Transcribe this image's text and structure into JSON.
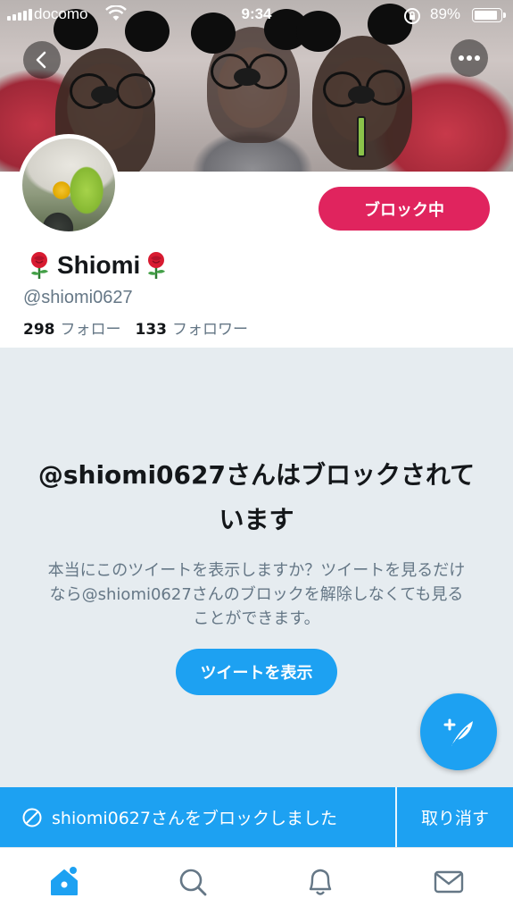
{
  "status_bar": {
    "carrier": "docomo",
    "time": "9:34",
    "battery_percent": "89%",
    "battery_level": 0.89,
    "icons": [
      "signal-bars-icon",
      "wifi-icon",
      "orientation-lock-icon",
      "battery-icon"
    ]
  },
  "header": {
    "back_icon": "chevron-left-icon",
    "more_icon": "more-dots-icon"
  },
  "profile": {
    "name_prefix_icon": "rose-icon",
    "display_name": "Shiomi",
    "name_suffix_icon": "rose-icon",
    "handle": "@shiomi0627",
    "following_count": "298",
    "following_label": "フォロー",
    "followers_count": "133",
    "followers_label": "フォロワー",
    "block_button_label": "ブロック中"
  },
  "blocked_notice": {
    "title": "@shiomi0627さんはブロックされています",
    "description": "本当にこのツイートを表示しますか？ツイートを見るだけなら@shiomi0627さんのブロックを解除しなくても見ることができます。",
    "show_button_label": "ツイートを表示"
  },
  "compose": {
    "icon": "compose-feather-icon"
  },
  "toast": {
    "icon": "block-icon",
    "message": "shiomi0627さんをブロックしました",
    "undo_label": "取り消す"
  },
  "tab_bar": {
    "tabs": [
      {
        "icon": "home-icon",
        "active": true,
        "has_dot": true
      },
      {
        "icon": "search-icon",
        "active": false
      },
      {
        "icon": "notifications-bell-icon",
        "active": false
      },
      {
        "icon": "messages-envelope-icon",
        "active": false
      }
    ]
  },
  "colors": {
    "accent_blue": "#1da1f2",
    "block_red": "#e0245e",
    "muted_gray": "#657786",
    "panel_bg": "#e6ecf0"
  }
}
